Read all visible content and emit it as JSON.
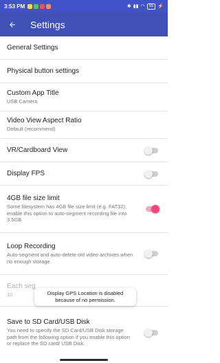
{
  "status_bar": {
    "time": "3:53 PM",
    "battery": "55",
    "colors": [
      "#ffd54f",
      "#66bb6a",
      "#ef5350",
      "#ff8a65"
    ]
  },
  "app_bar": {
    "back_icon": "arrow-left-icon",
    "title": "Settings"
  },
  "items": [
    {
      "title": "General Settings"
    },
    {
      "title": "Physical button settings"
    },
    {
      "title": "Custom App Title",
      "summary": "USB Camera"
    },
    {
      "title": "Video View Aspect Ratio",
      "summary": "Default (recommend)"
    },
    {
      "title": "VR/Cardboard View",
      "switch": false
    },
    {
      "title": "Display FPS",
      "switch": false
    },
    {
      "title": "4GB file size limit",
      "summary": "Some filesystem has 4GB file size limit (e.g. FAT32), enable this option to auto-segment recording file into 3.5GB",
      "switch": true
    },
    {
      "title": "Loop Recording",
      "summary": "Auto-segment and auto-delete old video archives when no enough storage.",
      "switch": false
    },
    {
      "title": "Each seg",
      "summary": "10"
    },
    {
      "title": "Save to SD Card/USB Disk",
      "summary": "You need to specify the SD Card/USB Disk storage path from the following option if you enable this option or replace the SD card/ USB Disk.",
      "switch": false
    }
  ],
  "toast": {
    "text": "Display GPS Location is disabled because of no permission."
  },
  "colors": {
    "primary": "#3f51b5",
    "accent": "#ff4081"
  }
}
